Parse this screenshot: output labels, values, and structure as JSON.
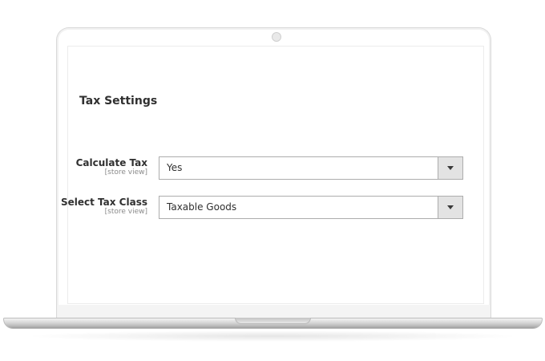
{
  "section": {
    "title": "Tax Settings"
  },
  "fields": [
    {
      "label": "Calculate Tax",
      "scope": "[store view]",
      "value": "Yes"
    },
    {
      "label": "Select Tax Class",
      "scope": "[store view]",
      "value": "Taxable Goods"
    }
  ],
  "icons": {
    "dropdown": "chevron-down-icon",
    "camera": "camera-icon"
  }
}
